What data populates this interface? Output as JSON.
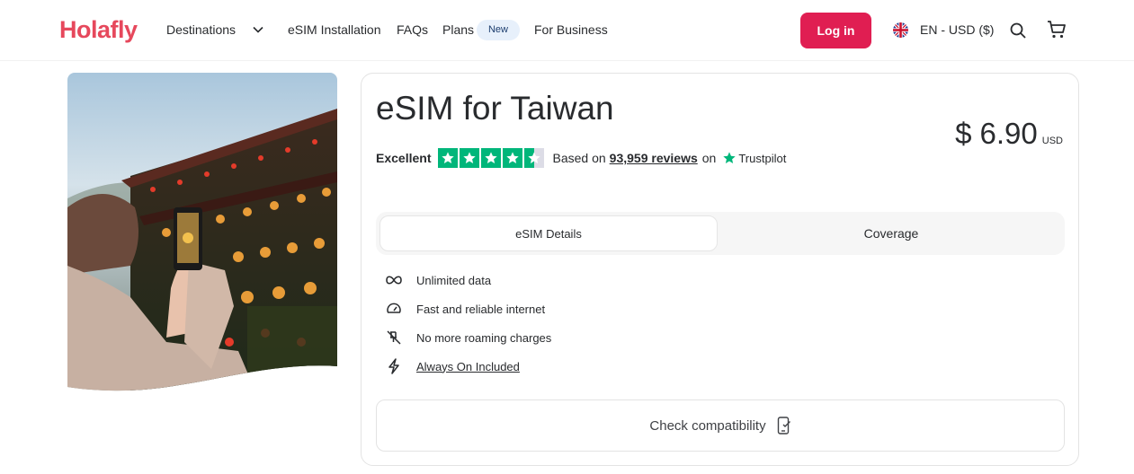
{
  "header": {
    "logo": "Holafly",
    "nav": {
      "destinations": "Destinations",
      "installation": "eSIM Installation",
      "faqs": "FAQs",
      "plans": "Plans",
      "plans_badge": "New",
      "business": "For Business"
    },
    "login": "Log in",
    "language": "EN - USD ($)"
  },
  "product": {
    "title": "eSIM for Taiwan",
    "rating_word": "Excellent",
    "rating_stars": 4.5,
    "based_on": "Based on",
    "reviews_count": "93,959 reviews",
    "on": "on",
    "trustpilot": "Trustpilot",
    "price_symbol": "$",
    "price_amount": "6.90",
    "price_currency": "USD"
  },
  "tabs": [
    {
      "label": "eSIM Details",
      "active": true
    },
    {
      "label": "Coverage",
      "active": false
    }
  ],
  "features": [
    {
      "icon": "infinity-icon",
      "label": "Unlimited data"
    },
    {
      "icon": "speedometer-icon",
      "label": "Fast and reliable internet"
    },
    {
      "icon": "no-roaming-icon",
      "label": "No more roaming charges"
    },
    {
      "icon": "lightning-icon",
      "label": "Always On Included"
    }
  ],
  "check_compatibility": "Check compatibility",
  "colors": {
    "brand": "#e6485c",
    "login_bg": "#e01e52",
    "trustpilot_green": "#00b67a"
  }
}
